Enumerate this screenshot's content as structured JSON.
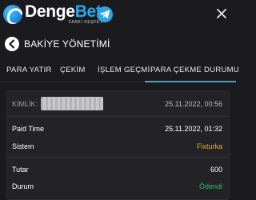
{
  "brand": {
    "name_part1": "Denge",
    "name_part2": "Bet",
    "tagline": "FARKI KEŞFET"
  },
  "icons": {
    "telegram": "telegram-icon",
    "close": "close-icon",
    "back": "chevron-left-icon",
    "logo": "yin-yang-logo-icon"
  },
  "colors": {
    "accent": "#2aa7ef",
    "pending": "#f1a81c",
    "success": "#20c35a",
    "background": "#1b1b1d",
    "card": "#232327"
  },
  "header": {
    "title": "BAKİYE YÖNETİMİ"
  },
  "tabs": [
    {
      "label": "PARA YATIR",
      "active": false
    },
    {
      "label": "ÇEKİM",
      "active": false
    },
    {
      "label": "İŞLEM GEÇMİ",
      "active": false
    },
    {
      "label": "PARA ÇEKME DURUMU",
      "active": true
    }
  ],
  "record": {
    "id_label": "KİMLİK:",
    "id_timestamp": "25.11.2022, 00:56",
    "rows": [
      {
        "label": "Paid Time",
        "value": "25.11.2022, 01:32"
      },
      {
        "label": "Sistem",
        "value": "Fixturka"
      },
      {
        "label": "Tutar",
        "value": "600"
      },
      {
        "label": "Durum",
        "value": "Ödendi"
      }
    ]
  }
}
